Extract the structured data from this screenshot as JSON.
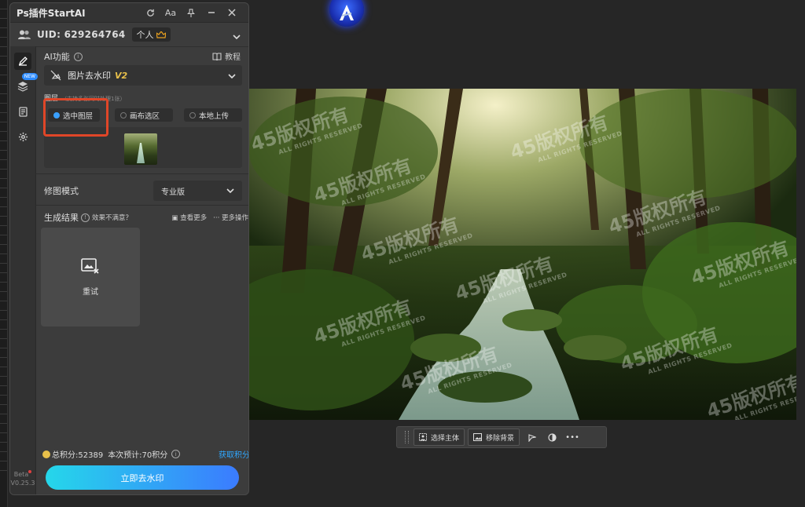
{
  "panel": {
    "title": "Ps插件StartAI",
    "uid_label": "UID: 629264764",
    "plan_badge": "个人",
    "sidebar_beta": "Beta",
    "sidebar_version": "V0.25.3",
    "sidebar_new_tag": "NEW"
  },
  "ai_function": {
    "heading": "AI功能",
    "tutorial": "教程",
    "selected_function": "图片去水印",
    "version_tag": "V2"
  },
  "layer_section": {
    "heading": "图层",
    "hint": "（支持多张同时处理1张）",
    "options": [
      "选中图层",
      "画布选区",
      "本地上传"
    ],
    "selected_index": 0
  },
  "mode": {
    "label": "修图模式",
    "value": "专业版"
  },
  "result": {
    "heading": "生成结果",
    "unsatisfied": "效果不满意？",
    "view_more": "查看更多",
    "more_actions": "更多操作",
    "retry": "重试"
  },
  "footer": {
    "total_points": "总积分:52389",
    "estimate": "本次预计:70积分",
    "get_points": "获取积分",
    "primary_button": "立即去水印"
  },
  "watermark": {
    "text": "45版权所有",
    "subtext": "ALL RIGHTS RESERVED"
  },
  "context_toolbar": {
    "select_subject": "选择主体",
    "remove_background": "移除背景"
  },
  "colors": {
    "accent_blue": "#2fa7ff",
    "highlight_red": "#e04628",
    "gold": "#e8c04a"
  }
}
